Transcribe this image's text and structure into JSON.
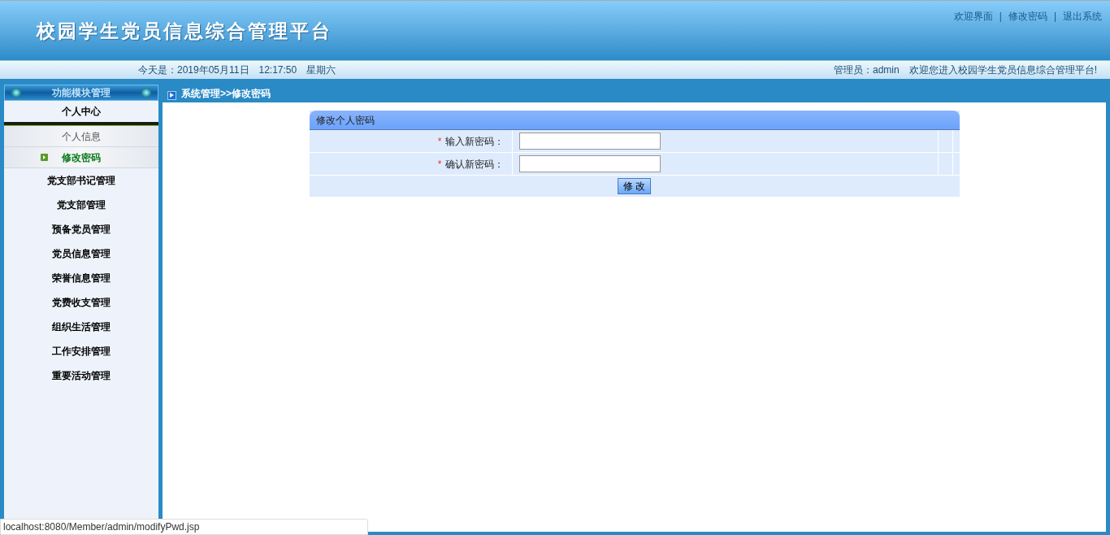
{
  "header": {
    "title": "校园学生党员信息综合管理平台",
    "links": [
      "欢迎界面",
      "修改密码",
      "退出系统"
    ],
    "separator": "|"
  },
  "info_bar": {
    "date": "今天是：2019年05月11日",
    "time": "12:17:50",
    "weekday": "星期六",
    "user": "管理员：admin",
    "welcome": "欢迎您进入校园学生党员信息综合管理平台!"
  },
  "sidebar": {
    "title": "功能模块管理",
    "items": [
      {
        "label": "个人中心",
        "expanded": true,
        "children": [
          {
            "label": "个人信息",
            "selected": false
          },
          {
            "label": "修改密码",
            "selected": true
          }
        ]
      },
      {
        "label": "党支部书记管理",
        "expanded": false
      },
      {
        "label": "党支部管理",
        "expanded": false
      },
      {
        "label": "预备党员管理",
        "expanded": false
      },
      {
        "label": "党员信息管理",
        "expanded": false
      },
      {
        "label": "荣誉信息管理",
        "expanded": false
      },
      {
        "label": "党费收支管理",
        "expanded": false
      },
      {
        "label": "组织生活管理",
        "expanded": false
      },
      {
        "label": "工作安排管理",
        "expanded": false
      },
      {
        "label": "重要活动管理",
        "expanded": false
      }
    ]
  },
  "breadcrumb": "系统管理>>修改密码",
  "form": {
    "title": "修改个人密码",
    "fields": [
      {
        "required_mark": "*",
        "label": "输入新密码："
      },
      {
        "required_mark": "*",
        "label": "确认新密码："
      }
    ],
    "submit": "修 改"
  },
  "status_url": "localhost:8080/Member/admin/modifyPwd.jsp"
}
